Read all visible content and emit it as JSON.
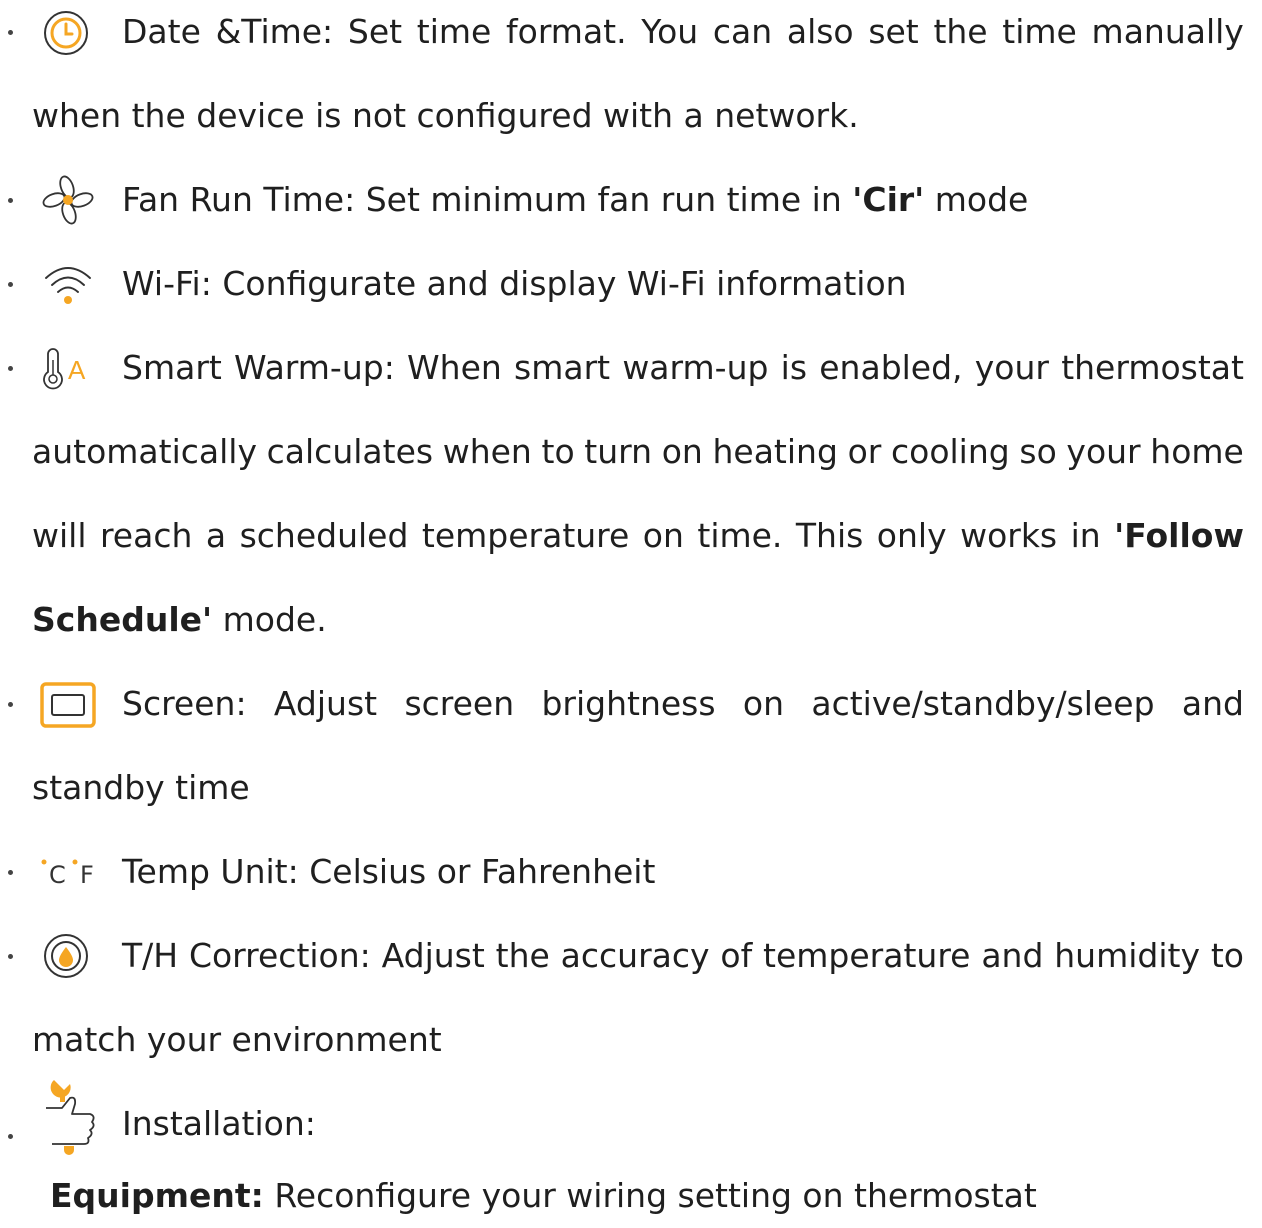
{
  "colors": {
    "accent": "#F5A623",
    "text": "#1f1f1f",
    "icon_stroke": "#333333"
  },
  "items": [
    {
      "icon": "clock-icon",
      "lines": [
        [
          "Date",
          "&Time:",
          "Set",
          "time",
          "format.",
          "You",
          "can",
          "also",
          "set",
          "the",
          "time",
          "manually"
        ],
        "when the device is not configured with a network."
      ]
    },
    {
      "icon": "fan-icon",
      "pre": "Fan Run Time: Set minimum fan run time in ",
      "bold": "'Cir'",
      "post": " mode"
    },
    {
      "icon": "wifi-icon",
      "text": "Wi-Fi: Configurate and display Wi-Fi information"
    },
    {
      "icon": "thermometer-auto-icon",
      "icon_letter": "A",
      "lines": [
        [
          "Smart",
          "Warm-up:",
          "When",
          "smart",
          "warm-up",
          "is",
          "enabled,",
          "your",
          "thermostat"
        ],
        [
          "automatically",
          "calculates",
          "when",
          "to",
          "turn",
          "on",
          "heating",
          "or",
          "cooling",
          "so",
          "your",
          "home"
        ],
        [
          "will",
          "reach",
          "a",
          "scheduled",
          "temperature",
          "on",
          "time.",
          "This",
          "only",
          "works",
          "in"
        ],
        "'Follow",
        "Schedule'",
        " mode."
      ]
    },
    {
      "icon": "screen-icon",
      "lines": [
        [
          "Screen:",
          "Adjust",
          "screen",
          "brightness",
          "on",
          "active/standby/sleep",
          "and"
        ],
        "standby time"
      ]
    },
    {
      "icon": "celsius-fahrenheit-icon",
      "icon_c": "C",
      "icon_f": "F",
      "text": "Temp Unit: Celsius or Fahrenheit"
    },
    {
      "icon": "droplet-icon",
      "lines": [
        [
          "T/H",
          "Correction:",
          "Adjust",
          "the",
          "accuracy",
          "of",
          "temperature",
          "and",
          "humidity",
          "to"
        ],
        "match your environment"
      ]
    },
    {
      "icon": "wrench-hand-icon",
      "text": "Installation:"
    }
  ],
  "equipment": {
    "label": "Equipment:",
    "text": " Reconfigure your wiring setting on thermostat"
  }
}
